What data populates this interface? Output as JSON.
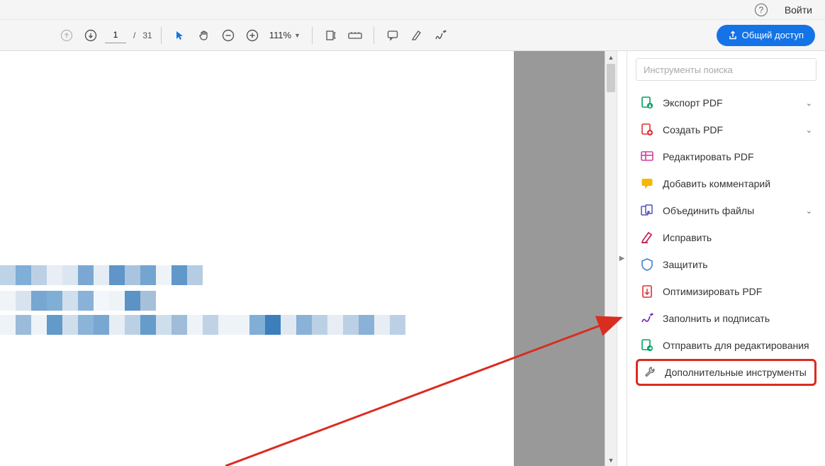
{
  "titlebar": {
    "signin_label": "Войти"
  },
  "toolbar": {
    "page_current": "1",
    "page_total": "31",
    "page_sep": "/",
    "zoom_value": "111%",
    "share_label": "Общий доступ"
  },
  "sidebar": {
    "search_placeholder": "Инструменты поиска",
    "tools": [
      {
        "label": "Экспорт PDF",
        "expandable": true,
        "icon": "export-pdf"
      },
      {
        "label": "Создать PDF",
        "expandable": true,
        "icon": "create-pdf"
      },
      {
        "label": "Редактировать PDF",
        "expandable": false,
        "icon": "edit-pdf"
      },
      {
        "label": "Добавить комментарий",
        "expandable": false,
        "icon": "comment"
      },
      {
        "label": "Объединить файлы",
        "expandable": true,
        "icon": "combine"
      },
      {
        "label": "Исправить",
        "expandable": false,
        "icon": "redact"
      },
      {
        "label": "Защитить",
        "expandable": false,
        "icon": "protect"
      },
      {
        "label": "Оптимизировать PDF",
        "expandable": false,
        "icon": "optimize"
      },
      {
        "label": "Заполнить и подписать",
        "expandable": false,
        "icon": "fill-sign"
      },
      {
        "label": "Отправить для редактирования",
        "expandable": false,
        "icon": "send-review"
      },
      {
        "label": "Дополнительные инструменты",
        "expandable": false,
        "icon": "more-tools",
        "highlighted": true
      }
    ]
  },
  "icon_colors": {
    "export-pdf": "#00a060",
    "create-pdf": "#e03030",
    "edit-pdf": "#d040a0",
    "comment": "#f5b800",
    "combine": "#5050c0",
    "redact": "#c02050",
    "protect": "#4080d0",
    "optimize": "#e03030",
    "fill-sign": "#8030c0",
    "send-review": "#00a060",
    "more-tools": "#707070"
  }
}
